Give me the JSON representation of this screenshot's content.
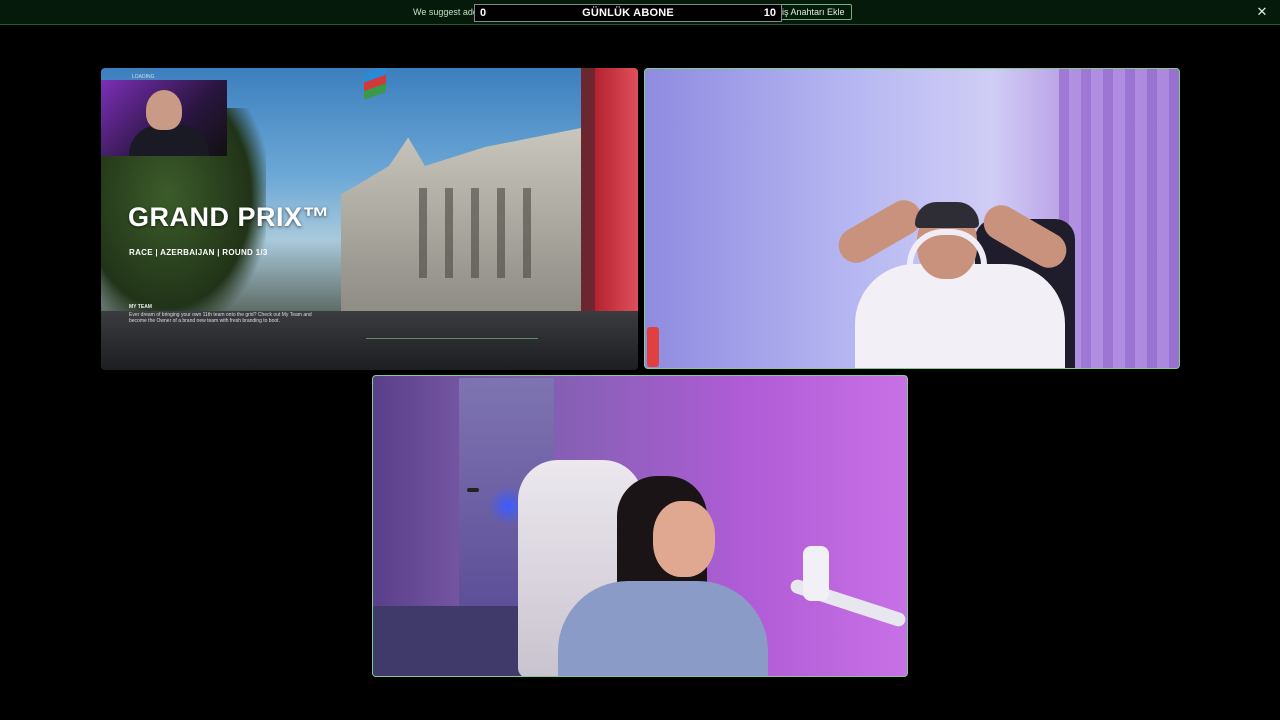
{
  "banner": {
    "text": "We suggest adding a passkey to your account for secure sign-ins.",
    "button_label": "Bir Geçiş Anahtarı Ekle",
    "close_glyph": "✕"
  },
  "subscriber_goal": {
    "current": "0",
    "label": "GÜNLÜK ABONE",
    "goal": "10"
  },
  "tiles": {
    "game": {
      "loading_label": "LOADING",
      "title": "GRAND PRIX™",
      "subtitle": "RACE | AZERBAIJAN | ROUND 1/3",
      "my_team_label": "MY TEAM",
      "description": "Ever dream of bringing your own 11th team onto the grid? Check out My Team and become the Owner of a brand new team with fresh branding to boot."
    }
  },
  "colors": {
    "background": "#000000",
    "banner_bg": "#061a0c",
    "active_border": "#7fd08f"
  }
}
